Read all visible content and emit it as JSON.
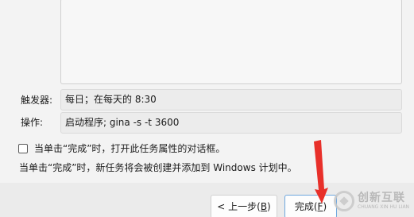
{
  "trigger": {
    "label": "触发器:",
    "value": "每日；在每天的 8:30"
  },
  "action": {
    "label": "操作:",
    "value": "启动程序; gina -s -t 3600"
  },
  "open_properties": {
    "checked": false,
    "label": "当单击“完成”时，打开此任务属性的对话框。"
  },
  "info": "当单击“完成”时，新任务将会被创建并添加到 Windows 计划中。",
  "buttons": {
    "back": {
      "prefix": "< 上一步(",
      "key": "B",
      "suffix": ")"
    },
    "finish": {
      "prefix": "完成(",
      "key": "F",
      "suffix": ")"
    }
  },
  "watermark": {
    "name": "创新互联",
    "sub": "CHUANG XIN HU LIAN"
  },
  "colors": {
    "arrow": "#e8302a",
    "finish_border": "#6fa7de",
    "background": "#f3f3f3"
  }
}
